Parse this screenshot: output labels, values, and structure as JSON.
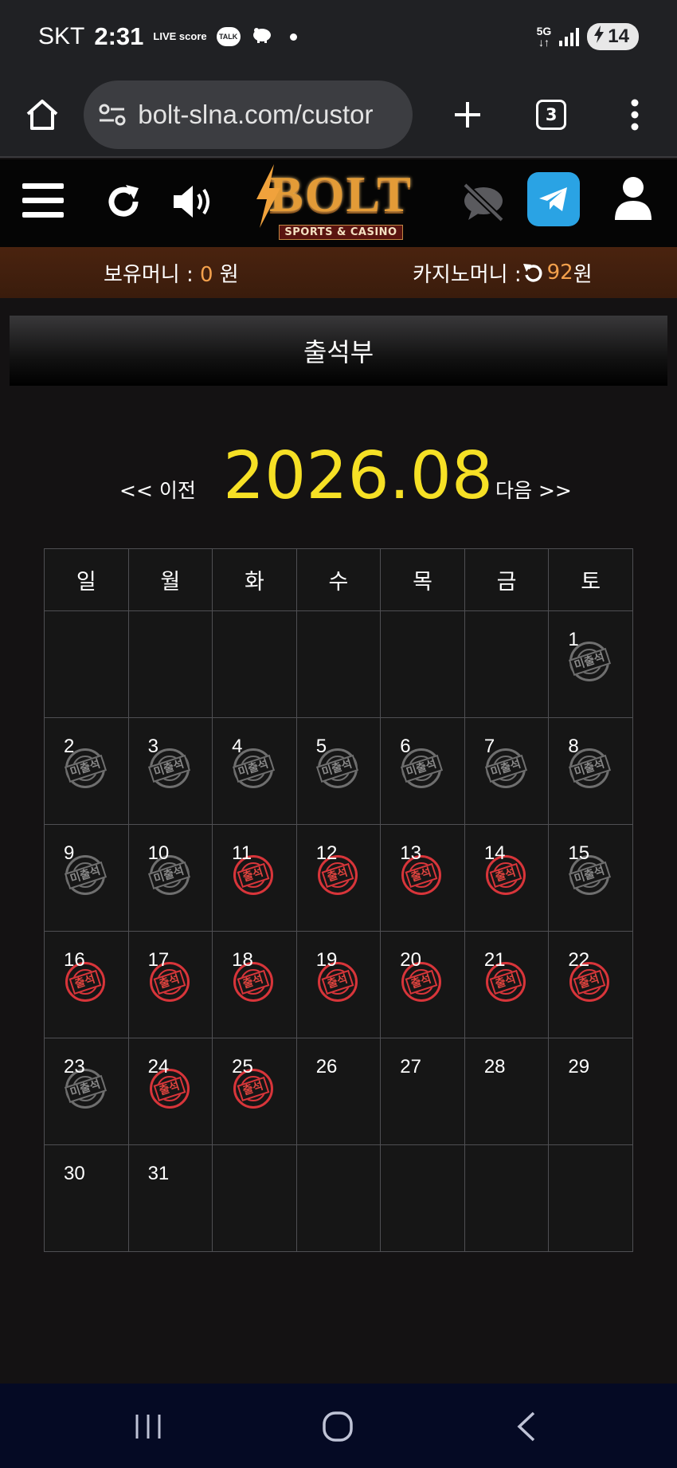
{
  "status_bar": {
    "carrier": "SKT",
    "time": "2:31",
    "live_icon_text": "LIVE score",
    "talk_icon_text": "TALK",
    "network": "5G",
    "battery": "14"
  },
  "browser": {
    "url": "bolt-slna.com/custor",
    "tab_count": "3"
  },
  "site": {
    "logo_text": "BOLT",
    "logo_sub": "SPORTS & CASINO"
  },
  "money": {
    "holding_label": "보유머니 : ",
    "holding_value": "0",
    "holding_unit": " 원",
    "casino_label": "카지노머니 : ",
    "casino_value": "92",
    "casino_unit": " 원"
  },
  "page": {
    "title": "출석부",
    "prev": "<< 이전",
    "next": "다음 >>",
    "month": "2026.08"
  },
  "calendar": {
    "weekdays": [
      "일",
      "월",
      "화",
      "수",
      "목",
      "금",
      "토"
    ],
    "weeks": [
      [
        null,
        null,
        null,
        null,
        null,
        null,
        {
          "day": "1",
          "status": "absent"
        }
      ],
      [
        {
          "day": "2",
          "status": "absent"
        },
        {
          "day": "3",
          "status": "absent"
        },
        {
          "day": "4",
          "status": "absent"
        },
        {
          "day": "5",
          "status": "absent"
        },
        {
          "day": "6",
          "status": "absent"
        },
        {
          "day": "7",
          "status": "absent"
        },
        {
          "day": "8",
          "status": "absent"
        }
      ],
      [
        {
          "day": "9",
          "status": "absent"
        },
        {
          "day": "10",
          "status": "absent"
        },
        {
          "day": "11",
          "status": "present"
        },
        {
          "day": "12",
          "status": "present"
        },
        {
          "day": "13",
          "status": "present"
        },
        {
          "day": "14",
          "status": "present"
        },
        {
          "day": "15",
          "status": "absent"
        }
      ],
      [
        {
          "day": "16",
          "status": "present"
        },
        {
          "day": "17",
          "status": "present"
        },
        {
          "day": "18",
          "status": "present"
        },
        {
          "day": "19",
          "status": "present"
        },
        {
          "day": "20",
          "status": "present"
        },
        {
          "day": "21",
          "status": "present"
        },
        {
          "day": "22",
          "status": "present"
        }
      ],
      [
        {
          "day": "23",
          "status": "absent"
        },
        {
          "day": "24",
          "status": "present"
        },
        {
          "day": "25",
          "status": "present"
        },
        {
          "day": "26",
          "status": "none"
        },
        {
          "day": "27",
          "status": "none"
        },
        {
          "day": "28",
          "status": "none"
        },
        {
          "day": "29",
          "status": "none"
        }
      ],
      [
        {
          "day": "30",
          "status": "none"
        },
        {
          "day": "31",
          "status": "none"
        },
        null,
        null,
        null,
        null,
        null
      ]
    ],
    "stamp_labels": {
      "present": "출석",
      "absent": "미출석"
    }
  },
  "colors": {
    "month_yellow": "#f6e025",
    "money_orange": "#f3a04c",
    "present_red": "#d8353a",
    "absent_gray": "#6f6f6f",
    "telegram_blue": "#2aa3e4"
  }
}
